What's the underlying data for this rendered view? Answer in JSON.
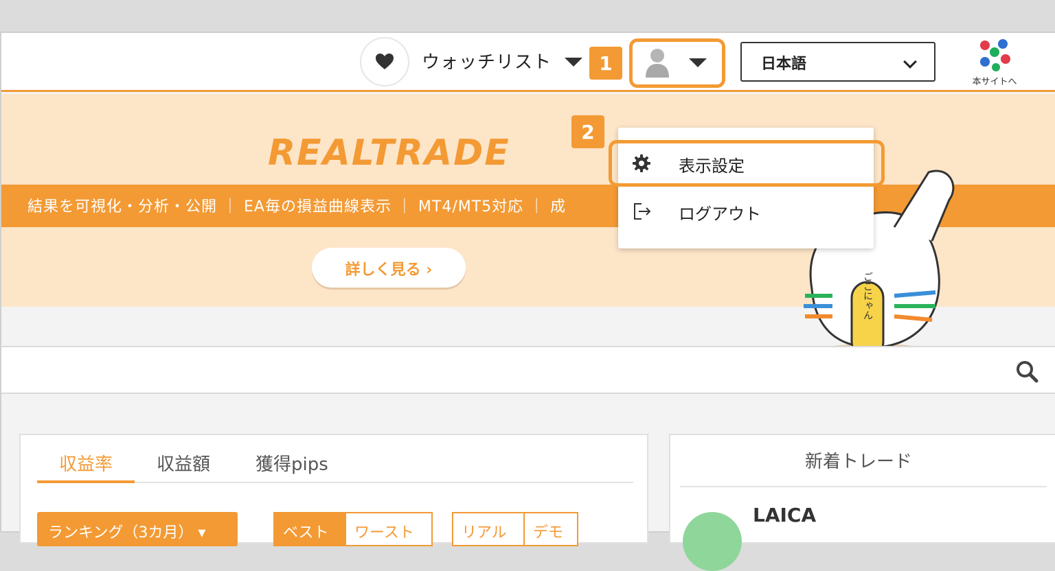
{
  "header": {
    "watchlist_label": "ウォッチリスト",
    "badge_1": "1",
    "badge_2": "2",
    "language_value": "日本語",
    "site_link_label": "本サイトへ"
  },
  "user_menu": {
    "items": [
      {
        "label": "表示設定",
        "icon": "gear-icon"
      },
      {
        "label": "ログアウト",
        "icon": "logout-icon"
      }
    ]
  },
  "banner": {
    "logo_text": "REALTRADE",
    "tagline": "結果を可視化・分析・公開 ｜ EA毎の損益曲線表示 ｜ MT4/MT5対応 ｜ 成",
    "more_button": "詳しく見る ›",
    "mascot_tag": "ごごにゃん"
  },
  "ranking_panel": {
    "tabs": [
      "収益率",
      "収益額",
      "獲得pips"
    ],
    "active_tab": 0,
    "period_button": "ランキング（3カ月） ▾",
    "segment_best_worst": [
      "ベスト",
      "ワースト"
    ],
    "segment_real_demo": [
      "リアル",
      "デモ"
    ]
  },
  "new_trades_panel": {
    "title": "新着トレード",
    "first_user": "LAICA"
  },
  "colors": {
    "accent": "#f39a34",
    "banner_bg": "#fde5c8"
  }
}
